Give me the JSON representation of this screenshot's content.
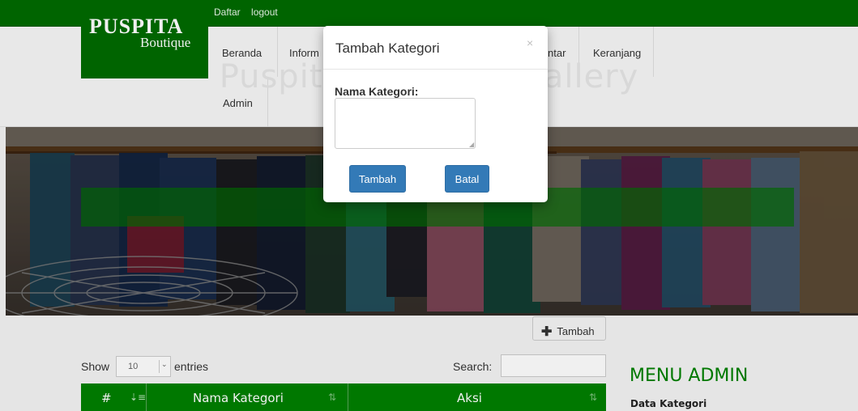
{
  "header": {
    "links": [
      "Daftar",
      "logout"
    ],
    "logo_line1": "PUSPITA",
    "logo_line2": "Boutique"
  },
  "nav": {
    "items": [
      "Beranda",
      "Inform",
      "ntar",
      "Keranjang",
      "Admin"
    ]
  },
  "hero": {
    "title": "Puspita Boutique Gallery"
  },
  "content": {
    "tambah_label": "Tambah",
    "show_label": "Show",
    "entries_value": "10",
    "entries_label": "entries",
    "search_label": "Search:",
    "table_headers": [
      "#",
      "Nama Kategori",
      "Aksi"
    ]
  },
  "sidebar": {
    "title": "MENU ADMIN",
    "items": [
      "Data Kategori"
    ]
  },
  "modal": {
    "title": "Tambah Kategori",
    "close": "×",
    "field_label": "Nama Kategori:",
    "submit_label": "Tambah",
    "cancel_label": "Batal"
  },
  "colors": {
    "brand_green": "#006b00",
    "table_green": "#008000",
    "primary_button": "#337ab7"
  }
}
